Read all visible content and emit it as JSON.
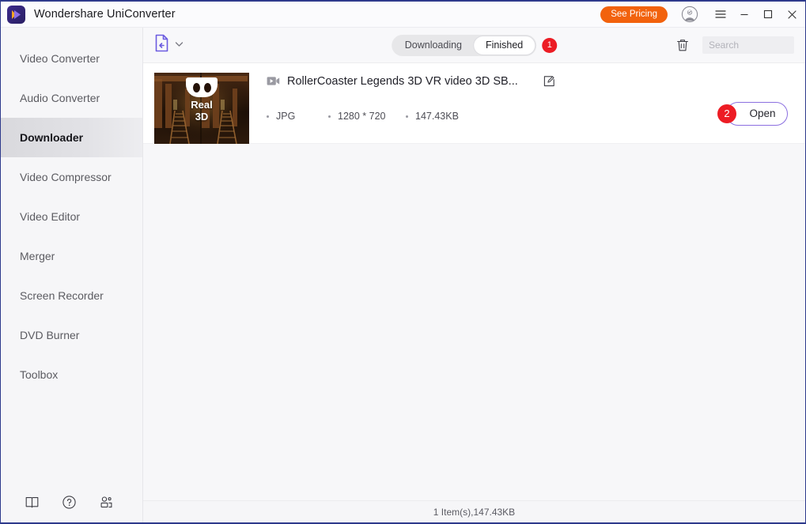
{
  "titlebar": {
    "app_title": "Wondershare UniConverter",
    "pricing_label": "See Pricing",
    "logo_icon": "uniconverter-logo-icon",
    "account_icon": "user-account-icon",
    "menu_icon": "hamburger-menu-icon",
    "minimize_icon": "minimize-icon",
    "maximize_icon": "maximize-icon",
    "close_icon": "close-icon"
  },
  "sidebar": {
    "items": [
      {
        "label": "Video Converter",
        "active": false
      },
      {
        "label": "Audio Converter",
        "active": false
      },
      {
        "label": "Downloader",
        "active": true
      },
      {
        "label": "Video Compressor",
        "active": false
      },
      {
        "label": "Video Editor",
        "active": false
      },
      {
        "label": "Merger",
        "active": false
      },
      {
        "label": "Screen Recorder",
        "active": false
      },
      {
        "label": "DVD Burner",
        "active": false
      },
      {
        "label": "Toolbox",
        "active": false
      }
    ],
    "footer_icons": [
      "guide-book-icon",
      "help-question-icon",
      "community-users-icon"
    ]
  },
  "toolbar": {
    "paste_url_icon": "paste-url-document-icon",
    "dropdown_icon": "chevron-down-icon",
    "tabs": [
      {
        "label": "Downloading",
        "active": false
      },
      {
        "label": "Finished",
        "active": true
      }
    ],
    "badge_count": "1",
    "trash_icon": "delete-trash-icon",
    "search_placeholder": "Search",
    "search_value": ""
  },
  "download_items": [
    {
      "thumbnail": {
        "overlay_icon": "vr-goggles-icon",
        "overlay_line1": "Real",
        "overlay_line2": "3D"
      },
      "type_icon": "video-file-icon",
      "title": "RollerCoaster Legends 3D VR video 3D SB...",
      "edit_icon": "edit-pencil-icon",
      "format": "JPG",
      "resolution": "1280 * 720",
      "size": "147.43KB",
      "action_label": "Open",
      "step_number": "2"
    }
  ],
  "footer": {
    "status": "1 Item(s),147.43KB"
  },
  "colors": {
    "accent_orange": "#f2620d",
    "accent_purple": "#6c5ce0",
    "badge_red": "#ed1c24",
    "window_border": "#2e3a8c"
  }
}
